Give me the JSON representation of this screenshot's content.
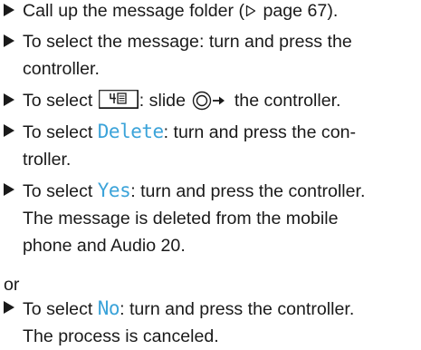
{
  "steps": [
    {
      "before": "Call up the message folder (",
      "ref_icon": "page-reference-icon",
      "after": " page 67)."
    },
    {
      "line1": "To select the message: turn and press the",
      "line2": "controller."
    },
    {
      "before": "To select ",
      "menu_icon": "message-menu-icon",
      "middle": ": slide ",
      "controller_icon": "controller-slide-right-icon",
      "after": " the controller."
    },
    {
      "before": "To select ",
      "highlight": "Delete",
      "after": ": turn and press the con-",
      "line2": "troller."
    },
    {
      "before": "To select ",
      "highlight": "Yes",
      "after": ": turn and press the controller.",
      "line2": "The message is deleted from the mobile",
      "line3": "phone and Audio 20."
    }
  ],
  "or_text": "or",
  "final_step": {
    "before": "To select ",
    "highlight": "No",
    "after": ": turn and press the controller.",
    "line2": "The process is canceled."
  },
  "colors": {
    "text": "#1a1a1a",
    "highlight": "#3ba3d9"
  }
}
